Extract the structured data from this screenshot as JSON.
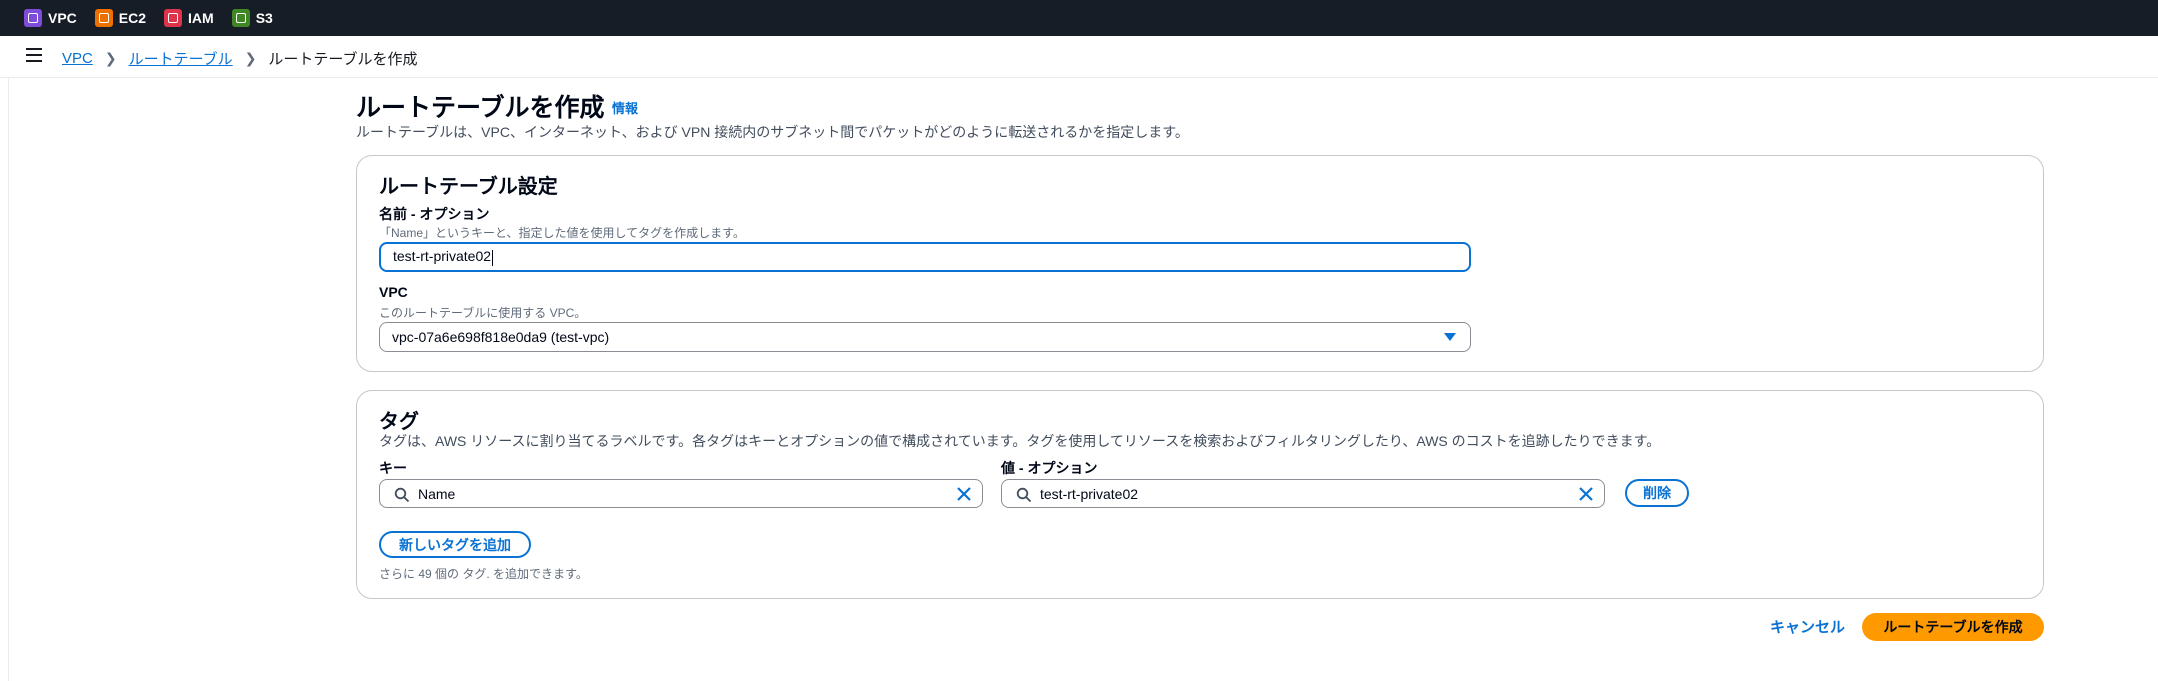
{
  "top_services": [
    {
      "label": "VPC",
      "icon": "vpc-icon",
      "color": "#7d4cdb"
    },
    {
      "label": "EC2",
      "icon": "ec2-icon",
      "color": "#ed7100"
    },
    {
      "label": "IAM",
      "icon": "iam-icon",
      "color": "#dd344c"
    },
    {
      "label": "S3",
      "icon": "s3-icon",
      "color": "#3f8624"
    }
  ],
  "breadcrumb": {
    "items": [
      "VPC",
      "ルートテーブル"
    ],
    "current": "ルートテーブルを作成"
  },
  "page": {
    "title": "ルートテーブルを作成",
    "info": "情報",
    "description": "ルートテーブルは、VPC、インターネット、および VPN 接続内のサブネット間でパケットがどのように転送されるかを指定します。"
  },
  "settings": {
    "title": "ルートテーブル設定",
    "name_label": "名前 - オプション",
    "name_hint": "「Name」というキーと、指定した値を使用してタグを作成します。",
    "name_value": "test-rt-private02",
    "vpc_label": "VPC",
    "vpc_hint": "このルートテーブルに使用する VPC。",
    "vpc_value": "vpc-07a6e698f818e0da9 (test-vpc)"
  },
  "tags": {
    "title": "タグ",
    "description": "タグは、AWS リソースに割り当てるラベルです。各タグはキーとオプションの値で構成されています。タグを使用してリソースを検索およびフィルタリングしたり、AWS のコストを追跡したりできます。",
    "key_label": "キー",
    "value_label": "値 - オプション",
    "key_value": "Name",
    "value_value": "test-rt-private02",
    "remove_label": "削除",
    "add_label": "新しいタグを追加",
    "remaining_text": "さらに 49 個の タグ. を追加できます。"
  },
  "actions": {
    "cancel": "キャンセル",
    "create": "ルートテーブルを作成"
  },
  "colors": {
    "accent": "#0972d3",
    "primary_button": "#ff9900",
    "topbar": "#161d26"
  }
}
